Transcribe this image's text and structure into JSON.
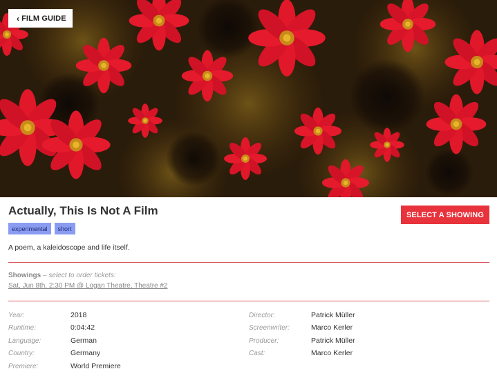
{
  "nav": {
    "back_label": "FILM GUIDE",
    "back_icon": "chevron-left-icon"
  },
  "hero": {
    "image": "red flowers kaleidoscope still"
  },
  "film": {
    "title": "Actually, This Is Not A Film",
    "tags": [
      "experimental",
      "short"
    ],
    "description": "A poem, a kaleidoscope and life itself."
  },
  "actions": {
    "select_showing_label": "SELECT A SHOWING"
  },
  "showings": {
    "heading": "Showings",
    "hint": " – select to order tickets:",
    "items": [
      "Sat, Jun 8th, 2:30 PM @ Logan Theatre, Theatre #2"
    ]
  },
  "details": {
    "left": [
      {
        "label": "Year:",
        "value": "2018"
      },
      {
        "label": "Runtime:",
        "value": "0:04:42"
      },
      {
        "label": "Language:",
        "value": "German"
      },
      {
        "label": "Country:",
        "value": "Germany"
      },
      {
        "label": "Premiere:",
        "value": "World Premiere"
      }
    ],
    "right": [
      {
        "label": "Director:",
        "value": "Patrick Müller"
      },
      {
        "label": "Screenwriter:",
        "value": "Marco Kerler"
      },
      {
        "label": "Producer:",
        "value": "Patrick Müller"
      },
      {
        "label": "Cast:",
        "value": "Marco Kerler"
      }
    ]
  },
  "colors": {
    "accent": "#e8323c",
    "tag_bg": "#8a9cf2",
    "rule": "#d9545a"
  }
}
